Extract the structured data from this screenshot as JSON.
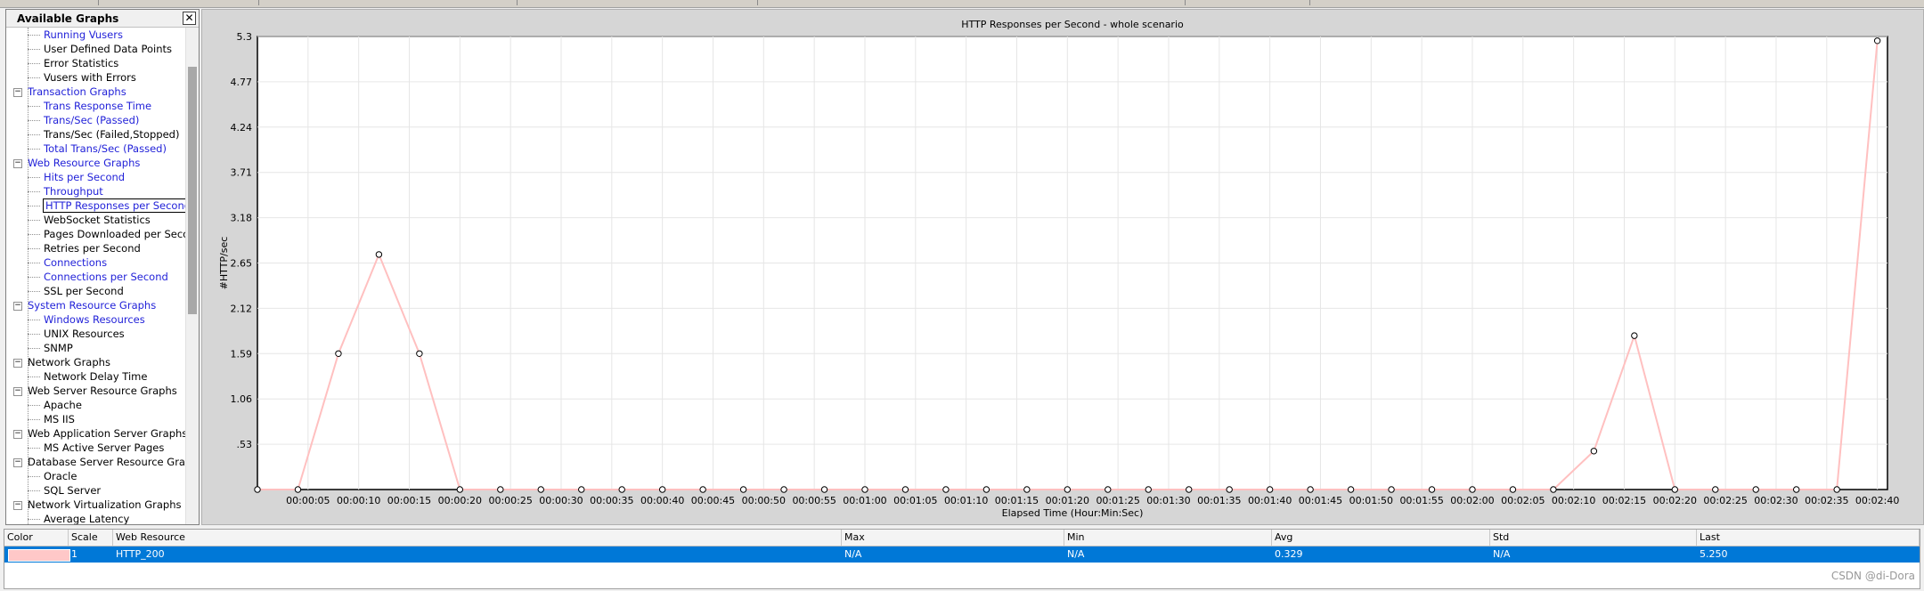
{
  "panel": {
    "title": "Available Graphs",
    "close": "✕",
    "tree": [
      {
        "type": "item",
        "label": "Running Vusers",
        "color": "blue"
      },
      {
        "type": "item",
        "label": "User Defined Data Points",
        "color": "black"
      },
      {
        "type": "item",
        "label": "Error Statistics",
        "color": "black"
      },
      {
        "type": "item",
        "label": "Vusers with Errors",
        "color": "black"
      },
      {
        "type": "group",
        "label": "Transaction Graphs",
        "color": "blue"
      },
      {
        "type": "item",
        "label": "Trans Response Time",
        "color": "blue"
      },
      {
        "type": "item",
        "label": "Trans/Sec (Passed)",
        "color": "blue"
      },
      {
        "type": "item",
        "label": "Trans/Sec (Failed,Stopped)",
        "color": "black"
      },
      {
        "type": "item",
        "label": "Total Trans/Sec (Passed)",
        "color": "blue"
      },
      {
        "type": "group",
        "label": "Web Resource Graphs",
        "color": "blue"
      },
      {
        "type": "item",
        "label": "Hits per Second",
        "color": "blue"
      },
      {
        "type": "item",
        "label": "Throughput",
        "color": "blue"
      },
      {
        "type": "item",
        "label": "HTTP Responses per Second",
        "color": "blue",
        "selected": true
      },
      {
        "type": "item",
        "label": "WebSocket Statistics",
        "color": "black"
      },
      {
        "type": "item",
        "label": "Pages Downloaded per Second",
        "color": "black"
      },
      {
        "type": "item",
        "label": "Retries per Second",
        "color": "black"
      },
      {
        "type": "item",
        "label": "Connections",
        "color": "blue"
      },
      {
        "type": "item",
        "label": "Connections per Second",
        "color": "blue"
      },
      {
        "type": "item",
        "label": "SSL per Second",
        "color": "black"
      },
      {
        "type": "group",
        "label": "System Resource Graphs",
        "color": "blue"
      },
      {
        "type": "item",
        "label": "Windows Resources",
        "color": "blue"
      },
      {
        "type": "item",
        "label": "UNIX Resources",
        "color": "black"
      },
      {
        "type": "item",
        "label": "SNMP",
        "color": "black"
      },
      {
        "type": "group",
        "label": "Network Graphs",
        "color": "black"
      },
      {
        "type": "item",
        "label": "Network Delay Time",
        "color": "black"
      },
      {
        "type": "group",
        "label": "Web Server Resource Graphs",
        "color": "black"
      },
      {
        "type": "item",
        "label": "Apache",
        "color": "black"
      },
      {
        "type": "item",
        "label": "MS IIS",
        "color": "black"
      },
      {
        "type": "group",
        "label": "Web Application Server Graphs",
        "color": "black"
      },
      {
        "type": "item",
        "label": "MS Active Server Pages",
        "color": "black"
      },
      {
        "type": "group",
        "label": "Database Server Resource Graphs",
        "color": "black"
      },
      {
        "type": "item",
        "label": "Oracle",
        "color": "black"
      },
      {
        "type": "item",
        "label": "SQL Server",
        "color": "black"
      },
      {
        "type": "group",
        "label": "Network Virtualization Graphs",
        "color": "black"
      },
      {
        "type": "item",
        "label": "Average Latency",
        "color": "black"
      }
    ]
  },
  "chart_data": {
    "type": "line",
    "title": "HTTP Responses per Second - whole scenario",
    "xlabel": "Elapsed Time (Hour:Min:Sec)",
    "ylabel": "#HTTP/sec",
    "ylim": [
      0,
      5.3
    ],
    "yticks": [
      "5.3",
      "4.77",
      "4.24",
      "3.71",
      "3.18",
      "2.65",
      "2.12",
      "1.59",
      "1.06",
      ".53"
    ],
    "ytick_values": [
      5.3,
      4.77,
      4.24,
      3.71,
      3.18,
      2.65,
      2.12,
      1.59,
      1.06,
      0.53
    ],
    "xlim_seconds": [
      0,
      161
    ],
    "xticks": [
      "00:00:05",
      "00:00:10",
      "00:00:15",
      "00:00:20",
      "00:00:25",
      "00:00:30",
      "00:00:35",
      "00:00:40",
      "00:00:45",
      "00:00:50",
      "00:00:55",
      "00:01:00",
      "00:01:05",
      "00:01:10",
      "00:01:15",
      "00:01:20",
      "00:01:25",
      "00:01:30",
      "00:01:35",
      "00:01:40",
      "00:01:45",
      "00:01:50",
      "00:01:55",
      "00:02:00",
      "00:02:05",
      "00:02:10",
      "00:02:15",
      "00:02:20",
      "00:02:25",
      "00:02:30",
      "00:02:35",
      "00:02:40"
    ],
    "grid": true,
    "series": [
      {
        "name": "HTTP_200",
        "color": "#ffc0c0",
        "x_seconds": [
          0,
          4,
          8,
          12,
          16,
          20,
          24,
          28,
          32,
          36,
          40,
          44,
          48,
          52,
          56,
          60,
          64,
          68,
          72,
          76,
          80,
          84,
          88,
          92,
          96,
          100,
          104,
          108,
          112,
          116,
          120,
          124,
          128,
          132,
          136,
          140,
          144,
          148,
          152,
          156,
          160
        ],
        "values": [
          0,
          0,
          1.59,
          2.75,
          1.59,
          0,
          0,
          0,
          0,
          0,
          0,
          0,
          0,
          0,
          0,
          0,
          0,
          0,
          0,
          0,
          0,
          0,
          0,
          0,
          0,
          0,
          0,
          0,
          0,
          0,
          0,
          0,
          0,
          0.45,
          1.8,
          0,
          0,
          0,
          0,
          0,
          5.25
        ]
      }
    ]
  },
  "legend": {
    "headers": [
      "Color",
      "Scale",
      "Web Resource",
      "Max",
      "Min",
      "Avg",
      "Std",
      "Last"
    ],
    "rows": [
      {
        "color": "#ffc8c8",
        "scale": "1",
        "resource": "HTTP_200",
        "max": "N/A",
        "min": "N/A",
        "avg": "0.329",
        "std": "N/A",
        "last": "5.250"
      }
    ]
  },
  "watermark": "CSDN @di-Dora"
}
